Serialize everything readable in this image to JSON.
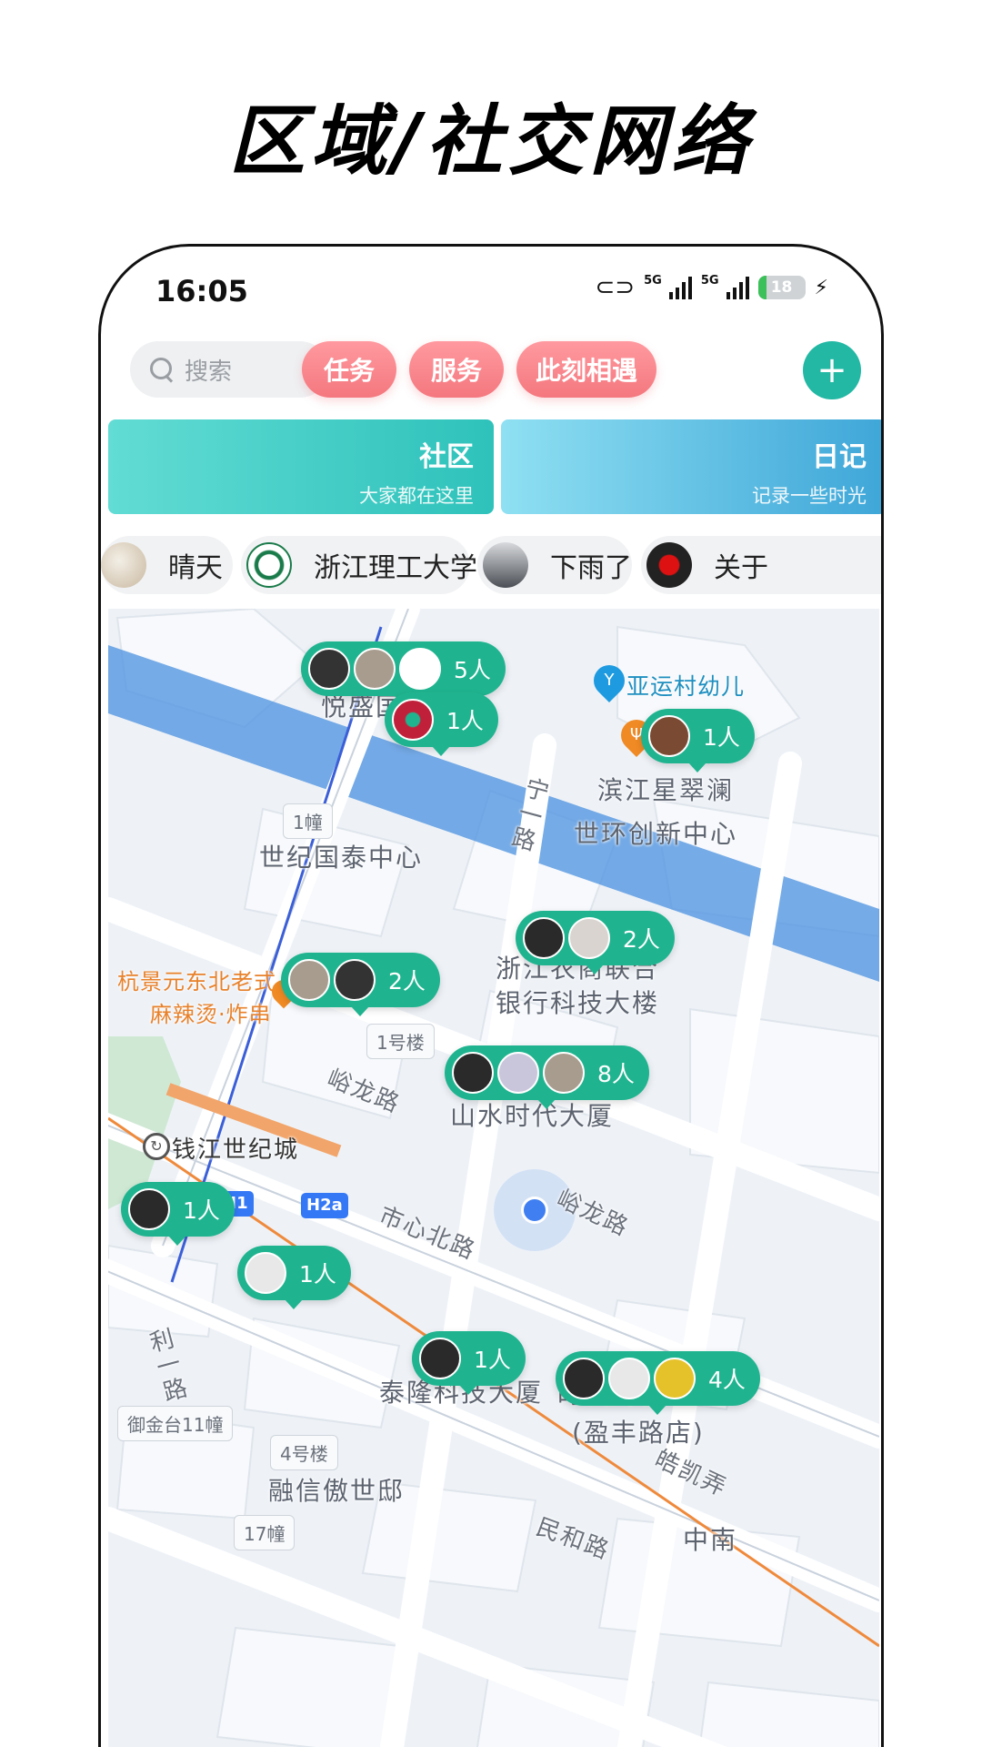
{
  "headline": "区域/社交网络",
  "status": {
    "time": "16:05",
    "net1": "5G",
    "net2": "5G",
    "battery": "18",
    "battery_level": 0.18
  },
  "toolbar": {
    "search_placeholder": "搜索",
    "buttons": [
      "任务",
      "服务",
      "此刻相遇"
    ],
    "add": "+"
  },
  "cards": {
    "community": {
      "title": "社区",
      "subtitle": "大家都在这里"
    },
    "diary": {
      "title": "日记",
      "subtitle": "记录一些时光"
    }
  },
  "chips": [
    "晴天",
    "浙江理工大学",
    "下雨了",
    "关于"
  ],
  "map": {
    "labels": {
      "yuesheng": "悦盛国",
      "yayun": "亚运村幼儿",
      "binjiang": "滨江星翠澜",
      "shihuan": "世环创新中心",
      "shiji": "世纪国泰中心",
      "ningyi": "宁一路",
      "zhejiang1": "浙江农商联合",
      "zhejiang2": "银行科技大楼",
      "hangjing1": "杭景元东北老式",
      "hangjing2": "麻辣烫·炸串",
      "yulong1": "峪龙路",
      "shanshui": "山水时代大厦",
      "qianjiang": "钱江世纪城",
      "shixin": "市心北路",
      "yulong2": "峪龙路",
      "liyi": "利一路",
      "tailong": "泰隆科技大厦",
      "shidai1": "时代财富中心",
      "shidai2": "(盈丰路店)",
      "rongxin": "融信傲世邸",
      "haokai": "皓凯弄",
      "minhe": "民和路",
      "zhongnan": "中南"
    },
    "tags": {
      "b1": "1幢",
      "lou1": "1号楼",
      "yujin": "御金台11幢",
      "lou4": "4号楼",
      "b17": "17幢"
    },
    "stations": {
      "h1": "H1",
      "h2a": "H2a"
    },
    "clusters": {
      "c1": "5人",
      "c2": "1人",
      "c3": "1人",
      "c4": "2人",
      "c5": "2人",
      "c6": "8人",
      "c7": "1人",
      "c8": "1人",
      "c9": "1人",
      "c10": "4人"
    }
  },
  "colors": {
    "teal": "#1fb48f",
    "pink": "#f4777e",
    "accent": "#22b8a4",
    "water": "#4a90e0"
  }
}
